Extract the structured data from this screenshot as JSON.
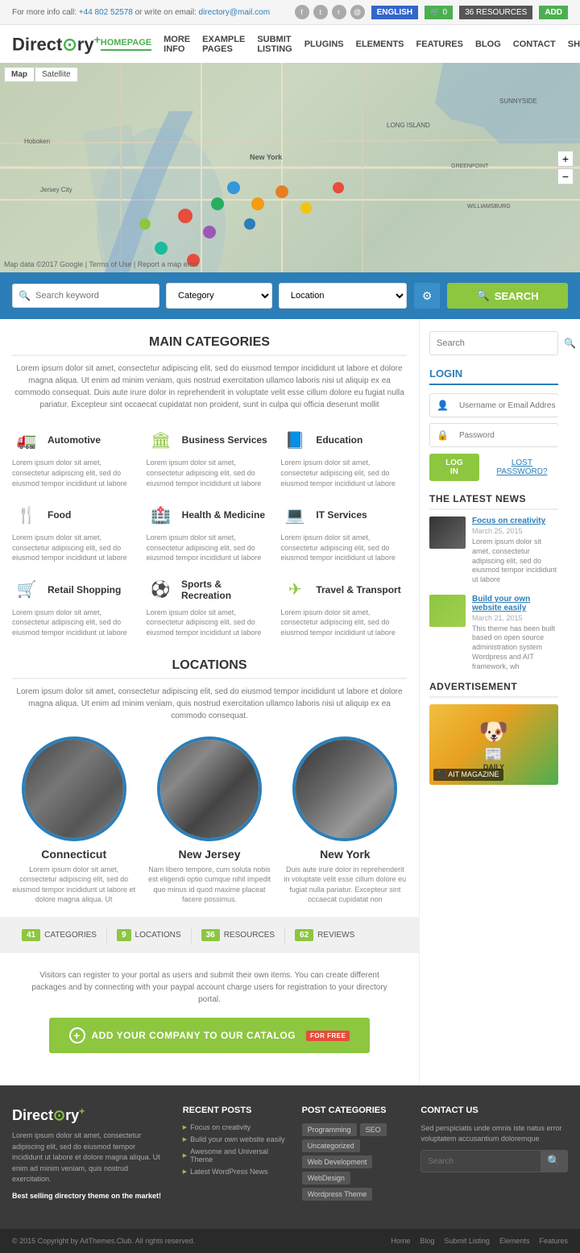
{
  "topbar": {
    "phone": "+44 802 52578",
    "email": "directory@mail.com",
    "info": "For more info call:",
    "write": "or write on email:",
    "lang": "ENGLISH",
    "cart_count": "0",
    "resources_count": "36 RESOURCES",
    "add_label": "ADD"
  },
  "header": {
    "logo": "Directory",
    "logo_plus": "+",
    "nav": [
      {
        "label": "HOMEPAGE",
        "active": true
      },
      {
        "label": "MORE INFO",
        "active": false
      },
      {
        "label": "EXAMPLE PAGES",
        "active": false
      },
      {
        "label": "SUBMIT LISTING",
        "active": false
      },
      {
        "label": "PLUGINS",
        "active": false
      },
      {
        "label": "ELEMENTS",
        "active": false
      },
      {
        "label": "FEATURES",
        "active": false
      },
      {
        "label": "BLOG",
        "active": false
      },
      {
        "label": "CONTACT",
        "active": false
      },
      {
        "label": "SHOP",
        "active": false
      }
    ]
  },
  "map": {
    "tab_map": "Map",
    "tab_satellite": "Satellite"
  },
  "search": {
    "keyword_placeholder": "Search keyword",
    "category_placeholder": "Category",
    "location_placeholder": "Location",
    "button_label": "SEARCH"
  },
  "main_categories": {
    "title": "MAIN CATEGORIES",
    "description": "Lorem ipsum dolor sit amet, consectetur adipiscing elit, sed do eiusmod tempor incididunt ut labore et dolore magna aliqua. Ut enim ad minim veniam, quis nostrud exercitation ullamco laboris nisi ut aliquip ex ea commodo consequat. Duis aute irure dolor in reprehenderit in voluptate velit esse cillum dolore eu fugiat nulla pariatur. Excepteur sint occaecat cupidatat non proident, sunt in culpa qui officia deserunt mollit",
    "categories": [
      {
        "name": "Automotive",
        "icon": "automotive",
        "desc": "Lorem ipsum dolor sit amet, consectetur adipiscing elit, sed do eiusmod tempor incididunt ut labore"
      },
      {
        "name": "Business Services",
        "icon": "business",
        "desc": "Lorem ipsum dolor sit amet, consectetur adipiscing elit, sed do eiusmod tempor incididunt ut labore"
      },
      {
        "name": "Education",
        "icon": "education",
        "desc": "Lorem ipsum dolor sit amet, consectetur adipiscing elit, sed do eiusmod tempor incididunt ut labore"
      },
      {
        "name": "Food",
        "icon": "food",
        "desc": "Lorem ipsum dolor sit amet, consectetur adipiscing elit, sed do eiusmod tempor incididunt ut labore"
      },
      {
        "name": "Health & Medicine",
        "icon": "health",
        "desc": "Lorem ipsum dolor sit amet, consectetur adipiscing elit, sed do eiusmod tempor incididunt ut labore"
      },
      {
        "name": "IT Services",
        "icon": "it",
        "desc": "Lorem ipsum dolor sit amet, consectetur adipiscing elit, sed do eiusmod tempor incididunt ut labore"
      },
      {
        "name": "Retail Shopping",
        "icon": "retail",
        "desc": "Lorem ipsum dolor sit amet, consectetur adipiscing elit, sed do eiusmod tempor incididunt ut labore"
      },
      {
        "name": "Sports & Recreation",
        "icon": "sports",
        "desc": "Lorem ipsum dolor sit amet, consectetur adipiscing elit, sed do eiusmod tempor incididunt ut labore"
      },
      {
        "name": "Travel & Transport",
        "icon": "travel",
        "desc": "Lorem ipsum dolor sit amet, consectetur adipiscing elit, sed do eiusmod tempor incididunt ut labore"
      }
    ]
  },
  "locations": {
    "title": "LOCATIONS",
    "description": "Lorem ipsum dolor sit amet, consectetur adipiscing elit, sed do eiusmod tempor incididunt ut labore et dolore magna aliqua. Ut enim ad minim veniam, quis nostrud exercitation ullamco laboris nisi ut aliquip ex ea commodo consequat.",
    "items": [
      {
        "name": "Connecticut",
        "desc": "Lorem ipsum dolor sit amet, consectetur adipiscing elit, sed do eiusmod tempor incididunt ut labore et dolore magna aliqua. Ut"
      },
      {
        "name": "New Jersey",
        "desc": "Nam libero tempore, cum soluta nobis est eligendi optio cumque nihil impedit quo minus id quod maxime placeat facere possimus."
      },
      {
        "name": "New York",
        "desc": "Duis aute irure dolor in reprehenderit in voluptate velit esse cillum dolore eu fugiat nulla pariatur. Excepteur sint occaecat cupidatat non"
      }
    ]
  },
  "stats": [
    {
      "num": "41",
      "label": "CATEGORIES"
    },
    {
      "num": "9",
      "label": "LOCATIONS"
    },
    {
      "num": "36",
      "label": "RESOURCES"
    },
    {
      "num": "62",
      "label": "REVIEWS"
    }
  ],
  "cta": {
    "description": "Visitors can register to your portal as users and submit their own items. You can create different packages and by connecting with your paypal account charge users for registration to your directory portal.",
    "button_label": "ADD YOUR COMPANY TO OUR CATALOG",
    "for_free": "FOR FREE"
  },
  "sidebar": {
    "search_placeholder": "Search",
    "login": {
      "title": "LOGIN",
      "username_placeholder": "Username or Email Addres",
      "password_placeholder": "Password",
      "login_btn": "LOG IN",
      "lost_btn": "LOST PASSWORD?"
    },
    "latest_news": {
      "title": "THE LATEST NEWS",
      "items": [
        {
          "title": "Focus on creativity",
          "date": "March 25, 2015",
          "desc": "Lorem ipsum dolor sit amet, consectetur adipiscing elit, sed do eiusmod tempor incididunt ut labore"
        },
        {
          "title": "Build your own website easily",
          "date": "March 21, 2015",
          "desc": "This theme has been built based on open source administration system Wordpress and AIT framework, wh"
        }
      ]
    },
    "advertisement": {
      "title": "ADVERTISEMENT"
    }
  },
  "footer": {
    "logo": "Directory",
    "logo_plus": "+",
    "desc": "Lorem ipsum dolor sit amet, consectetur adipiscing elit, sed do eiusmod tempor incididunt ut labore et dolore magna aliqua. Ut enim ad minim veniam, quis nostrud exercitation.",
    "tagline": "Best selling directory theme on the market!",
    "recent_posts": {
      "title": "RECENT POSTS",
      "items": [
        "Focus on creativity",
        "Build your own website easily",
        "Awesome and Universal Theme",
        "Latest WordPress News"
      ]
    },
    "post_categories": {
      "title": "POST CATEGORIES",
      "tags": [
        "Programming",
        "SEO",
        "Uncategorized",
        "Web Development",
        "WebDesign",
        "Wordpress Theme"
      ]
    },
    "contact": {
      "title": "CONTACT US",
      "desc": "Sed perspiciatis unde omnis iste natus error voluptatem accusantium doloremque",
      "search_placeholder": "Search"
    },
    "copyright": "© 2015 Copyright by AitThemes.Club. All rights reserved.",
    "nav": [
      "Home",
      "Blog",
      "Submit Listing",
      "Elements",
      "Features"
    ]
  }
}
